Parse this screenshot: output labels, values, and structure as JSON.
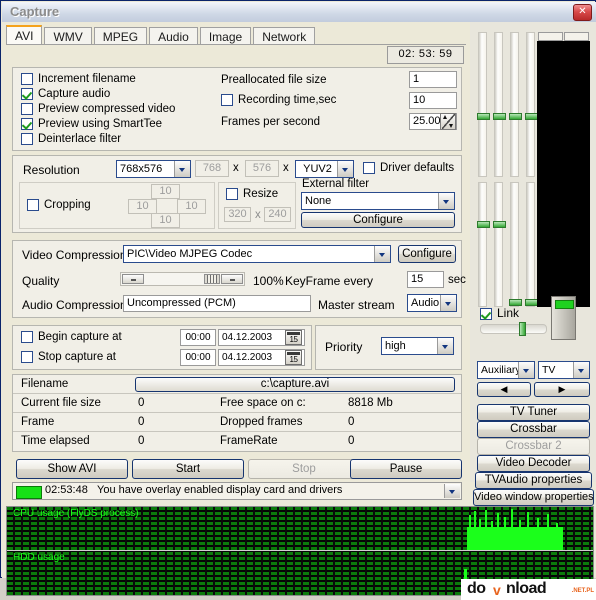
{
  "window": {
    "title": "Capture",
    "close_label": "✕"
  },
  "tabs": [
    {
      "label": "AVI",
      "active": true
    },
    {
      "label": "WMV",
      "active": false
    },
    {
      "label": "MPEG",
      "active": false
    },
    {
      "label": "Audio",
      "active": false
    },
    {
      "label": "Image",
      "active": false
    },
    {
      "label": "Network",
      "active": false
    }
  ],
  "timer": "02: 53: 59",
  "options": {
    "checkboxes": [
      {
        "label": "Increment filename",
        "checked": false
      },
      {
        "label": "Capture audio",
        "checked": true
      },
      {
        "label": "Preview compressed video",
        "checked": false
      },
      {
        "label": "Preview using SmartTee",
        "checked": true
      },
      {
        "label": "Deinterlace filter",
        "checked": false
      }
    ],
    "prealloc_label": "Preallocated file size",
    "prealloc_value": "1",
    "rectime_label": "Recording time,sec",
    "rectime_checked": false,
    "rectime_value": "10",
    "fps_label": "Frames per second",
    "fps_value": "25.00"
  },
  "resolution": {
    "label": "Resolution",
    "preset": "768x576",
    "width": "768",
    "x1": "x",
    "height": "576",
    "x2": "x",
    "format": "YUV2",
    "driver_defaults_label": "Driver defaults",
    "driver_defaults_checked": false
  },
  "cropping": {
    "label": "Cropping",
    "checked": false,
    "top": "10",
    "left": "10",
    "right": "10",
    "bottom": "10"
  },
  "resize": {
    "label": "Resize",
    "checked": false,
    "width": "320",
    "x": "x",
    "height": "240"
  },
  "external_filter": {
    "title": "External filter",
    "value": "None",
    "configure_label": "Configure"
  },
  "compression": {
    "video_label": "Video Compression",
    "video_value": "PIC\\Video MJPEG Codec",
    "configure_label": "Configure",
    "quality_label": "Quality",
    "quality_value": "100%",
    "keyframe_label": "KeyFrame every",
    "keyframe_value": "15",
    "keyframe_unit": "sec",
    "audio_label": "Audio Compression",
    "audio_value": "Uncompressed (PCM)",
    "master_label": "Master stream",
    "master_value": "Audio"
  },
  "schedule": {
    "begin_label": "Begin capture at",
    "begin_checked": false,
    "begin_time": "00:00",
    "begin_date": "04.12.2003",
    "stop_label": "Stop capture at",
    "stop_checked": false,
    "stop_time": "00:00",
    "stop_date": "04.12.2003",
    "cal_glyph": "15",
    "priority_label": "Priority",
    "priority_value": "high"
  },
  "status": {
    "filename_label": "Filename",
    "filename_value": "c:\\capture.avi",
    "rows": [
      {
        "label": "Current file size",
        "value": "0",
        "label2": "Free space on c:",
        "value2": "8818 Mb"
      },
      {
        "label": "Frame",
        "value": "0",
        "label2": "Dropped frames",
        "value2": "0"
      },
      {
        "label": "Time elapsed",
        "value": "0",
        "label2": "FrameRate",
        "value2": "0"
      }
    ]
  },
  "actions": [
    {
      "label": "Show AVI",
      "enabled": true
    },
    {
      "label": "Start",
      "enabled": true
    },
    {
      "label": "Stop",
      "enabled": false
    },
    {
      "label": "Pause",
      "enabled": true
    }
  ],
  "message": {
    "time": "02:53:48",
    "text": "You have overlay enabled display card and drivers",
    "led_color": "#16e016"
  },
  "graph": {
    "cpu_label": "CPU usage (FlyDS process)",
    "hdd_label": "HDD usage",
    "trace_color": "#1bff1b",
    "grid_color": "#0b7a0b"
  },
  "right_panel": {
    "link_label": "Link",
    "link_checked": true,
    "source_select": "Auxiliary",
    "input_select": "TV",
    "prev_label": "◀",
    "next_label": "▶",
    "buttons": [
      {
        "label": "TV Tuner",
        "enabled": true
      },
      {
        "label": "Crossbar",
        "enabled": true
      },
      {
        "label": "Crossbar 2",
        "enabled": false
      },
      {
        "label": "Video Decoder",
        "enabled": true
      },
      {
        "label": "TVAudio properties",
        "enabled": true
      },
      {
        "label": "Video window properties",
        "enabled": true
      }
    ]
  },
  "watermark": {
    "pre": "do",
    "v": "v",
    "post": "nload",
    "suffix": ".NET.PL"
  }
}
